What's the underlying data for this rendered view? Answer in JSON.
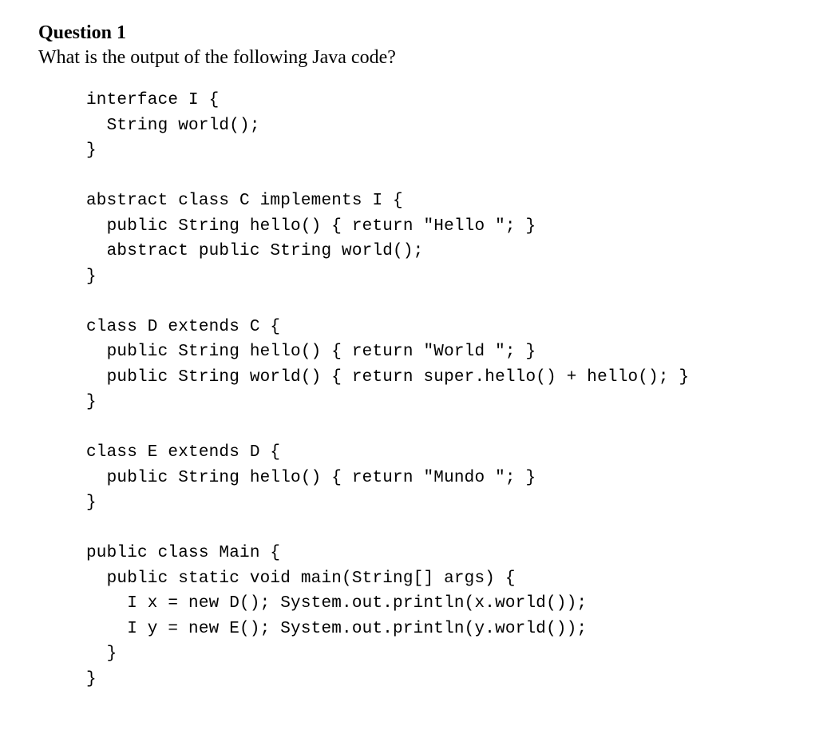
{
  "header": {
    "title": "Question 1",
    "prompt": "What is the output of the following Java code?"
  },
  "code": {
    "lines": [
      "interface I {",
      "  String world();",
      "}",
      "",
      "abstract class C implements I {",
      "  public String hello() { return \"Hello \"; }",
      "  abstract public String world();",
      "}",
      "",
      "class D extends C {",
      "  public String hello() { return \"World \"; }",
      "  public String world() { return super.hello() + hello(); }",
      "}",
      "",
      "class E extends D {",
      "  public String hello() { return \"Mundo \"; }",
      "}",
      "",
      "public class Main {",
      "  public static void main(String[] args) {",
      "    I x = new D(); System.out.println(x.world());",
      "    I y = new E(); System.out.println(y.world());",
      "  }",
      "}"
    ]
  }
}
